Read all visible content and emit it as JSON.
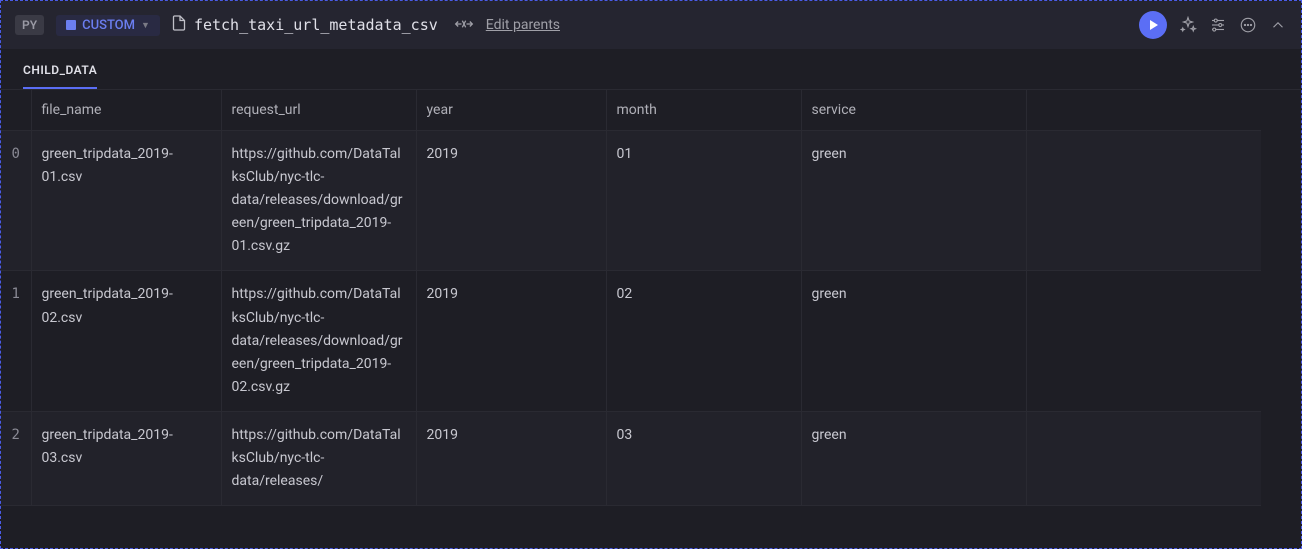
{
  "header": {
    "lang_badge": "PY",
    "type_badge": "CUSTOM",
    "file_name": "fetch_taxi_url_metadata_csv",
    "edit_parents_label": "Edit parents"
  },
  "tabs": [
    {
      "label": "CHILD_DATA",
      "active": true
    }
  ],
  "table": {
    "columns": [
      "file_name",
      "request_url",
      "year",
      "month",
      "service"
    ],
    "rows": [
      {
        "idx": "0",
        "file_name": "green_tripdata_2019-01.csv",
        "request_url": "https://github.com/DataTalksClub/nyc-tlc-data/releases/download/green/green_tripdata_2019-01.csv.gz",
        "year": "2019",
        "month": "01",
        "service": "green"
      },
      {
        "idx": "1",
        "file_name": "green_tripdata_2019-02.csv",
        "request_url": "https://github.com/DataTalksClub/nyc-tlc-data/releases/download/green/green_tripdata_2019-02.csv.gz",
        "year": "2019",
        "month": "02",
        "service": "green"
      },
      {
        "idx": "2",
        "file_name": "green_tripdata_2019-03.csv",
        "request_url": "https://github.com/DataTalksClub/nyc-tlc-data/releases/",
        "year": "2019",
        "month": "03",
        "service": "green"
      }
    ]
  }
}
